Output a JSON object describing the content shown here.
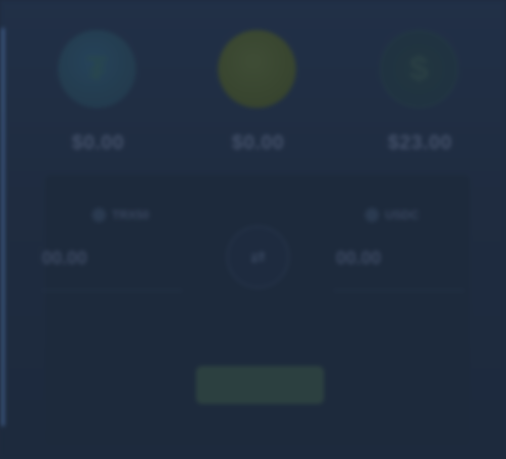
{
  "balances": [
    {
      "icon": "tether-coin-icon",
      "glyph": "₮",
      "amount": "$0.00"
    },
    {
      "icon": "gold-coin-icon",
      "glyph": "",
      "amount": "$0.00"
    },
    {
      "icon": "dollar-coin-icon",
      "glyph": "$",
      "amount": "$23.00"
    }
  ],
  "swap": {
    "from_token": "TRX50",
    "from_value": "00.00",
    "to_token": "USDC",
    "to_value": "00.00",
    "swap_glyph": "⇄",
    "action_label": ""
  },
  "colors": {
    "background": "#1f2b3e",
    "accent_line": "#4f73a8"
  }
}
